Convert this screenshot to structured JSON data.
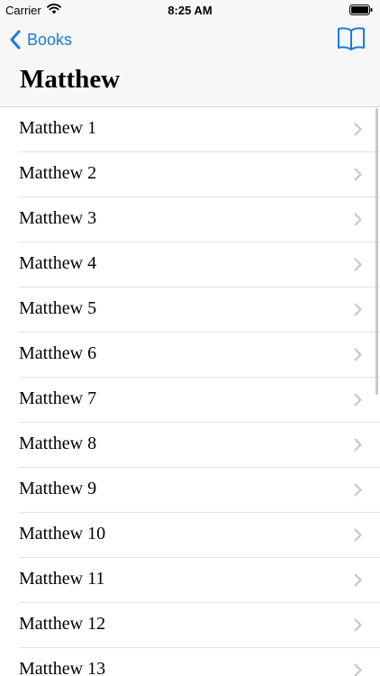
{
  "status_bar": {
    "carrier": "Carrier",
    "time": "8:25 AM"
  },
  "nav": {
    "back_label": "Books",
    "title": "Matthew",
    "accent_color": "#1a7ae0"
  },
  "chapters": [
    "Matthew 1",
    "Matthew 2",
    "Matthew 3",
    "Matthew 4",
    "Matthew 5",
    "Matthew 6",
    "Matthew 7",
    "Matthew 8",
    "Matthew 9",
    "Matthew 10",
    "Matthew 11",
    "Matthew 12",
    "Matthew 13"
  ]
}
